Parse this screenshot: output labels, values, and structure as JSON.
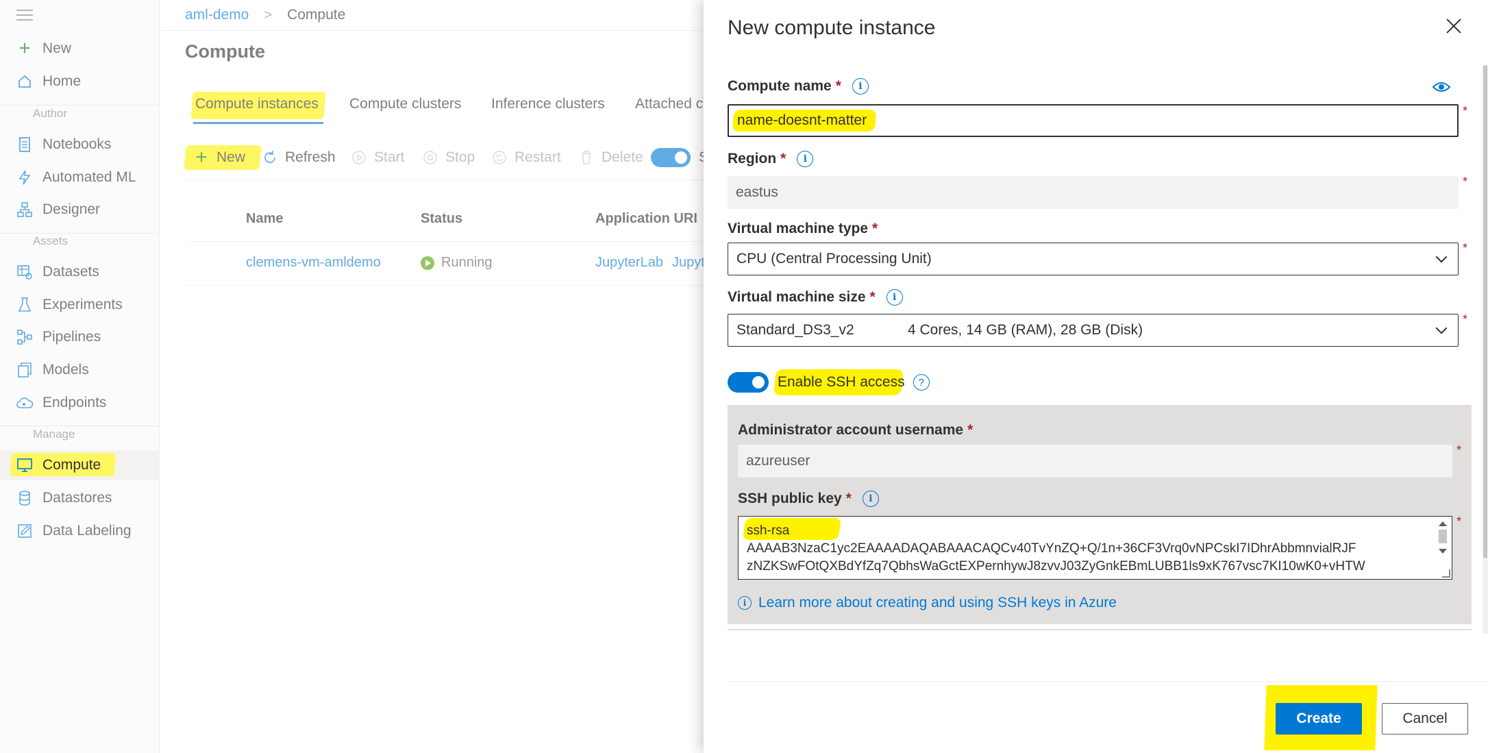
{
  "nav": {
    "new_label": "New",
    "home_label": "Home",
    "author_section": "Author",
    "notebooks_label": "Notebooks",
    "automl_label": "Automated ML",
    "designer_label": "Designer",
    "assets_section": "Assets",
    "datasets_label": "Datasets",
    "experiments_label": "Experiments",
    "pipelines_label": "Pipelines",
    "models_label": "Models",
    "endpoints_label": "Endpoints",
    "manage_section": "Manage",
    "compute_label": "Compute",
    "datastores_label": "Datastores",
    "labeling_label": "Data Labeling"
  },
  "breadcrumb": {
    "workspace": "aml-demo",
    "separator": ">",
    "current": "Compute"
  },
  "page": {
    "title": "Compute",
    "tabs": [
      "Compute instances",
      "Compute clusters",
      "Inference clusters",
      "Attached c"
    ],
    "toolbar": {
      "new": "New",
      "refresh": "Refresh",
      "start": "Start",
      "stop": "Stop",
      "restart": "Restart",
      "delete": "Delete",
      "toggle_trailing": "S"
    },
    "table": {
      "headers": {
        "name": "Name",
        "status": "Status",
        "uri": "Application URI"
      },
      "rows": [
        {
          "name": "clemens-vm-amldemo",
          "status": "Running",
          "uri1": "JupyterLab",
          "uri2": "Jupyt"
        }
      ]
    }
  },
  "panel": {
    "title": "New compute instance",
    "compute_name_label": "Compute name",
    "compute_name_value": "name-doesnt-matter",
    "region_label": "Region",
    "region_value": "eastus",
    "vm_type_label": "Virtual machine type",
    "vm_type_value": "CPU (Central Processing Unit)",
    "vm_size_label": "Virtual machine size",
    "vm_size_name": "Standard_DS3_v2",
    "vm_size_specs": "4 Cores, 14 GB (RAM), 28 GB (Disk)",
    "ssh_toggle_label": "Enable SSH access",
    "admin_user_label": "Administrator account username",
    "admin_user_value": "azureuser",
    "ssh_key_label": "SSH public key",
    "ssh_key_lines": [
      "ssh-rsa",
      "AAAAB3NzaC1yc2EAAAADAQABAAACAQCv40TvYnZQ+Q/1n+36CF3Vrq0vNPCskI7IDhrAbbmnvialRJF",
      "zNZKSwFOtQXBdYfZq7QbhsWaGctEXPernhywJ8zvvJ03ZyGnkEBmLUBB1ls9xK767vsc7KI10wK0+vHTW"
    ],
    "learn_more": "Learn more about creating and using SSH keys in Azure",
    "required_star": "*",
    "create_label": "Create",
    "cancel_label": "Cancel"
  },
  "colors": {
    "accent": "#0078d4",
    "highlight": "#fff200",
    "running": "#57a300",
    "required": "#a4262c"
  }
}
